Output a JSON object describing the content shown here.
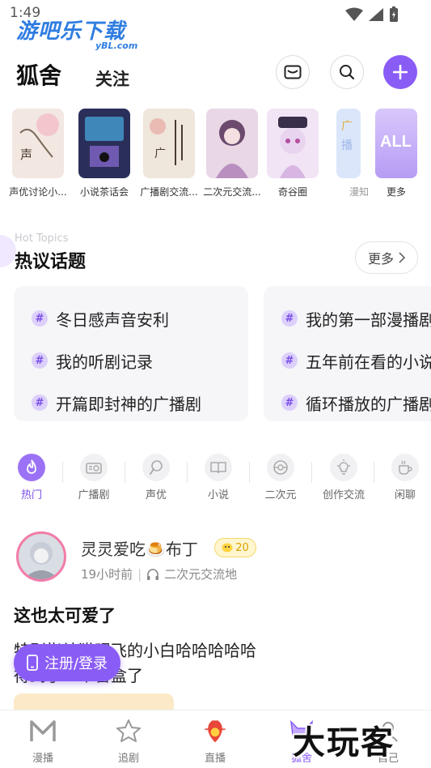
{
  "status_bar": {
    "time": "1:49"
  },
  "watermark": {
    "top_logo": "游吧乐下载",
    "top_logo_sub": "yBL.com",
    "bottom_logo": "大玩客"
  },
  "header": {
    "tabs": [
      {
        "label": "狐舍",
        "active": true
      },
      {
        "label": "关注",
        "active": false
      }
    ],
    "icons": [
      "mail-icon",
      "search-icon",
      "plus-icon"
    ]
  },
  "circles": [
    {
      "label": "声优讨论小...",
      "color": "#f3e7e2"
    },
    {
      "label": "小说茶话会",
      "color": "#2a2f5a"
    },
    {
      "label": "广播剧交流...",
      "color": "#efe6dc"
    },
    {
      "label": "二次元交流...",
      "color": "#e9d7e6"
    },
    {
      "label": "奇谷圈",
      "color": "#f1e4f5"
    },
    {
      "label": "漫知",
      "color": "#dbe6fb"
    },
    {
      "label": "更多",
      "color": "#c9b6f7",
      "badge": "ALL"
    }
  ],
  "hot_topics": {
    "subtitle_en": "Hot Topics",
    "title": "热议话题",
    "more_label": "更多",
    "cards": [
      {
        "topics": [
          "冬日感声音安利",
          "我的听剧记录",
          "开篇即封神的广播剧"
        ]
      },
      {
        "topics": [
          "我的第一部漫播剧",
          "五年前在看的小说",
          "循环播放的广播剧"
        ]
      }
    ]
  },
  "categories": [
    {
      "label": "热门",
      "icon": "flame-icon",
      "active": true
    },
    {
      "label": "广播剧",
      "icon": "radio-icon",
      "active": false
    },
    {
      "label": "声优",
      "icon": "microphone-icon",
      "active": false
    },
    {
      "label": "小说",
      "icon": "book-icon",
      "active": false
    },
    {
      "label": "二次元",
      "icon": "pokeball-icon",
      "active": false
    },
    {
      "label": "创作交流",
      "icon": "lightbulb-icon",
      "active": false
    },
    {
      "label": "闲聊",
      "icon": "coffee-icon",
      "active": false
    }
  ],
  "post": {
    "username": "灵灵爱吃🍮布丁",
    "level": "20",
    "time": "19小时前",
    "separator": "|",
    "circle": "二次元交流地",
    "title": "这也太可爱了",
    "body_line1": "特别指站猫眼飞的小白哈哈哈哈哈",
    "body_line2": "得到了一个盲盒了"
  },
  "register_button": {
    "label": "注册/登录"
  },
  "bottom_nav": [
    {
      "label": "漫播",
      "icon": "manbo-logo-icon",
      "active": false
    },
    {
      "label": "追剧",
      "icon": "star-icon",
      "active": false
    },
    {
      "label": "直播",
      "icon": "live-bag-icon",
      "active": false
    },
    {
      "label": "狐舍",
      "icon": "fox-icon",
      "active": true
    },
    {
      "label": "自己",
      "icon": "profile-icon",
      "active": false
    }
  ],
  "colors": {
    "accent": "#8a5cf6",
    "card_bg": "#f6f5f8"
  }
}
